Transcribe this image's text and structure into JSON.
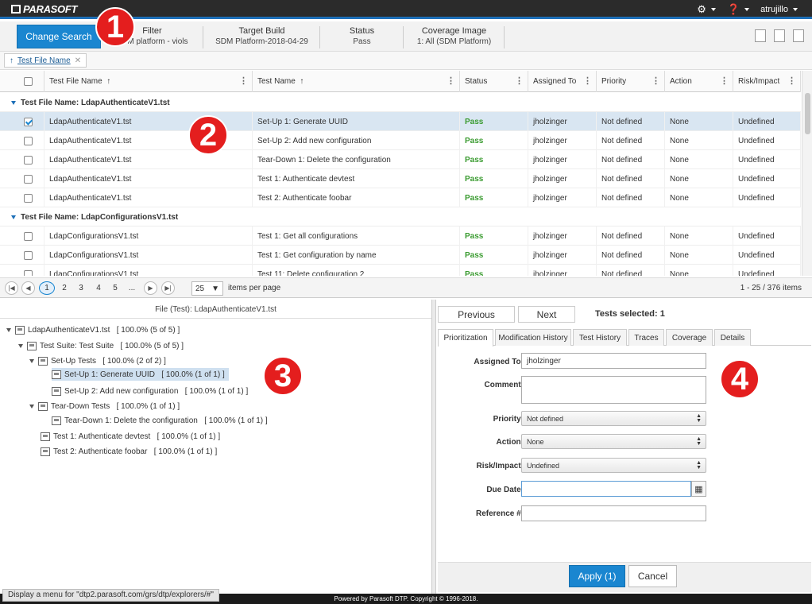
{
  "app": {
    "logo": "PARASOFT",
    "user": "atrujillo"
  },
  "search": {
    "change_label": "Change Search",
    "columns": [
      {
        "label": "Filter",
        "value": "SDM platform - viols"
      },
      {
        "label": "Target Build",
        "value": "SDM Platform-2018-04-29"
      },
      {
        "label": "Status",
        "value": "Pass"
      },
      {
        "label": "Coverage Image",
        "value": "1: All (SDM Platform)"
      }
    ]
  },
  "chip": {
    "label": "Test File Name"
  },
  "grid": {
    "headers": [
      "Test File Name",
      "Test Name",
      "Status",
      "Assigned To",
      "Priority",
      "Action",
      "Risk/Impact"
    ],
    "group1": "Test File Name: LdapAuthenticateV1.tst",
    "group2": "Test File Name: LdapConfigurationsV1.tst",
    "rows": [
      {
        "file": "LdapAuthenticateV1.tst",
        "name": "Set-Up 1: Generate UUID",
        "status": "Pass",
        "assigned": "jholzinger",
        "priority": "Not defined",
        "action": "None",
        "risk": "Undefined"
      },
      {
        "file": "LdapAuthenticateV1.tst",
        "name": "Set-Up 2: Add new configuration",
        "status": "Pass",
        "assigned": "jholzinger",
        "priority": "Not defined",
        "action": "None",
        "risk": "Undefined"
      },
      {
        "file": "LdapAuthenticateV1.tst",
        "name": "Tear-Down 1: Delete the configuration",
        "status": "Pass",
        "assigned": "jholzinger",
        "priority": "Not defined",
        "action": "None",
        "risk": "Undefined"
      },
      {
        "file": "LdapAuthenticateV1.tst",
        "name": "Test 1: Authenticate devtest",
        "status": "Pass",
        "assigned": "jholzinger",
        "priority": "Not defined",
        "action": "None",
        "risk": "Undefined"
      },
      {
        "file": "LdapAuthenticateV1.tst",
        "name": "Test 2: Authenticate foobar",
        "status": "Pass",
        "assigned": "jholzinger",
        "priority": "Not defined",
        "action": "None",
        "risk": "Undefined"
      },
      {
        "file": "LdapConfigurationsV1.tst",
        "name": "Test 1: Get all configurations",
        "status": "Pass",
        "assigned": "jholzinger",
        "priority": "Not defined",
        "action": "None",
        "risk": "Undefined"
      },
      {
        "file": "LdapConfigurationsV1.tst",
        "name": "Test 1: Get configuration by name",
        "status": "Pass",
        "assigned": "jholzinger",
        "priority": "Not defined",
        "action": "None",
        "risk": "Undefined"
      },
      {
        "file": "LdapConfigurationsV1.tst",
        "name": "Test 11: Delete configuration 2",
        "status": "Pass",
        "assigned": "jholzinger",
        "priority": "Not defined",
        "action": "None",
        "risk": "Undefined"
      }
    ]
  },
  "pager": {
    "pages": [
      "1",
      "2",
      "3",
      "4",
      "5",
      "..."
    ],
    "per_page": "25",
    "per_page_label": "items per page",
    "range": "1 - 25 / 376 items"
  },
  "tree": {
    "title": "File (Test): LdapAuthenticateV1.tst",
    "nodes": [
      "LdapAuthenticateV1.tst   [ 100.0% (5 of 5) ]",
      "Test Suite: Test Suite   [ 100.0% (5 of 5) ]",
      "Set-Up Tests   [ 100.0% (2 of 2) ]",
      "Set-Up 1: Generate UUID   [ 100.0% (1 of 1) ]",
      "Set-Up 2: Add new configuration   [ 100.0% (1 of 1) ]",
      "Tear-Down Tests   [ 100.0% (1 of 1) ]",
      "Tear-Down 1: Delete the configuration   [ 100.0% (1 of 1) ]",
      "Test 1: Authenticate devtest   [ 100.0% (1 of 1) ]",
      "Test 2: Authenticate foobar   [ 100.0% (1 of 1) ]"
    ]
  },
  "detail": {
    "previous": "Previous",
    "next": "Next",
    "selected": "Tests selected: 1",
    "tabs": [
      "Prioritization",
      "Modification History",
      "Test History",
      "Traces",
      "Coverage",
      "Details"
    ],
    "labels": {
      "assigned": "Assigned To:",
      "comment": "Comment:",
      "priority": "Priority:",
      "action": "Action:",
      "risk": "Risk/Impact:",
      "due": "Due Date:",
      "ref": "Reference #:"
    },
    "values": {
      "assigned": "jholzinger",
      "comment": "",
      "priority": "Not defined",
      "action": "None",
      "risk": "Undefined",
      "due": "",
      "ref": ""
    },
    "apply": "Apply (1)",
    "cancel": "Cancel"
  },
  "footer": {
    "copyright": "Powered by Parasoft DTP. Copyright © 1996-2018.",
    "status_tip": "Display a menu for \"dtp2.parasoft.com/grs/dtp/explorers/#\""
  },
  "badges": [
    "1",
    "2",
    "3",
    "4"
  ]
}
